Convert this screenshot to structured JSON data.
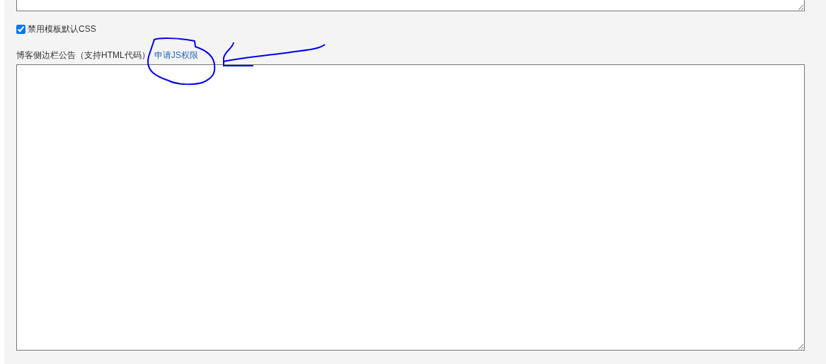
{
  "disable_default_css": {
    "label": "禁用模板默认CSS",
    "checked": true
  },
  "sidebar_notice": {
    "label": "博客侧边栏公告（支持HTML代码）",
    "link": "申请JS权限"
  }
}
